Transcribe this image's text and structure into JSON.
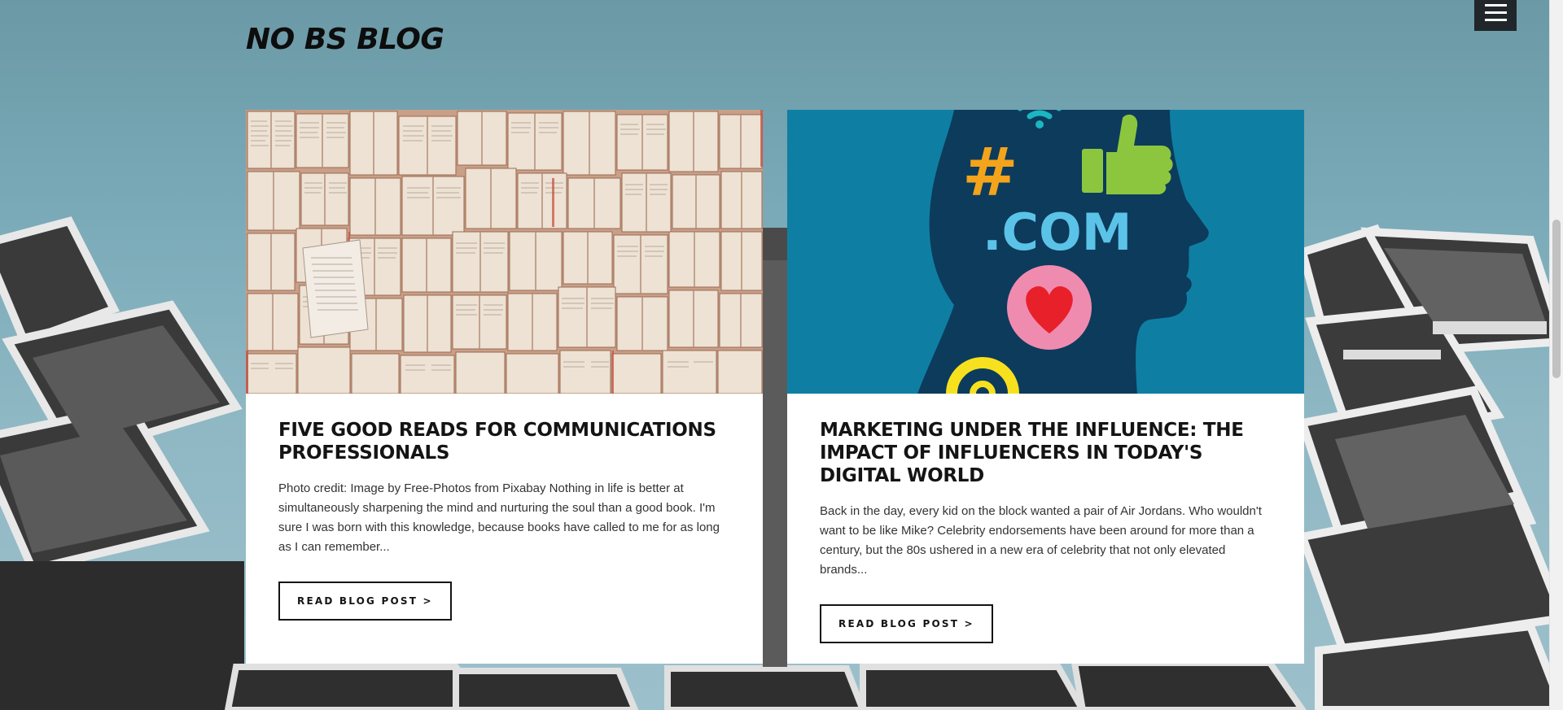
{
  "header": {
    "site_title": "NO BS BLOG",
    "menu_icon": "hamburger-menu-icon"
  },
  "posts": [
    {
      "title": "FIVE GOOD READS FOR COMMUNICATIONS PROFESSIONALS",
      "excerpt": "Photo credit: Image by Free-Photos from Pixabay Nothing in life is better at simultaneously sharpening the mind and nurturing the soul than a good book. I'm sure I was born with this knowledge, because books have called to me for as long as I can remember...",
      "button_label": "READ BLOG POST  >",
      "image_description_icon": "open-books-image"
    },
    {
      "title": "MARKETING UNDER THE INFLUENCE: THE IMPACT OF INFLUENCERS IN TODAY'S DIGITAL WORLD",
      "excerpt": "Back in the day, every kid on the block wanted a pair of Air Jordans. Who wouldn't want to be like Mike? Celebrity endorsements have been around for more than a century, but the 80s ushered in a new era of celebrity that not only elevated brands...",
      "button_label": "READ BLOG POST  >",
      "image_description_icon": "social-media-head-image",
      "image_text": {
        "hash": "#",
        "com": ".COM"
      }
    }
  ],
  "colors": {
    "sky": "#7aaab8",
    "card_bg": "#ffffff",
    "text_dark": "#141414",
    "influencer_bg": "#0e7fa3",
    "influencer_head": "#0d3b5c",
    "hash_orange": "#f3a41b",
    "thumb_green": "#8cc63f",
    "com_blue": "#5bc3e8",
    "heart_red": "#e8202a",
    "heart_pink": "#f08bb0",
    "at_yellow": "#f7e11e"
  }
}
